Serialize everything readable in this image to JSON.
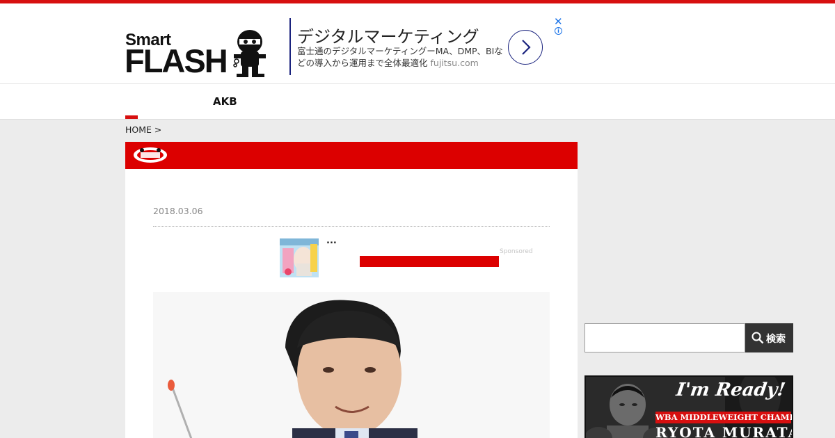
{
  "brand": {
    "logo_small": "Smart",
    "logo_large": "FLASH",
    "accent_color": "#d70f0f"
  },
  "ad": {
    "title": "デジタルマーケティング",
    "description": "富士通のデジタルマーケティングーMA、DMP、BIなどの導入から運用まで全体最適化",
    "domain": "fujitsu.com",
    "close_icon": "close-icon",
    "info_icon": "info-icon",
    "arrow_icon": "chevron-right-icon"
  },
  "nav": {
    "items": [
      {
        "label": "AKB"
      }
    ]
  },
  "breadcrumb": {
    "home": "HOME",
    "separator": ">"
  },
  "article": {
    "date": "2018.03.06"
  },
  "recommendation": {
    "title": "...",
    "sponsored_label": "Sponsored"
  },
  "sidebar": {
    "search": {
      "button_label": "検索",
      "button_icon": "search-icon"
    },
    "banner": {
      "tagline": "I'm Ready!",
      "title": "WBA MIDDLEWEIGHT CHAMPION",
      "name": "RYOTA MURATA"
    }
  }
}
